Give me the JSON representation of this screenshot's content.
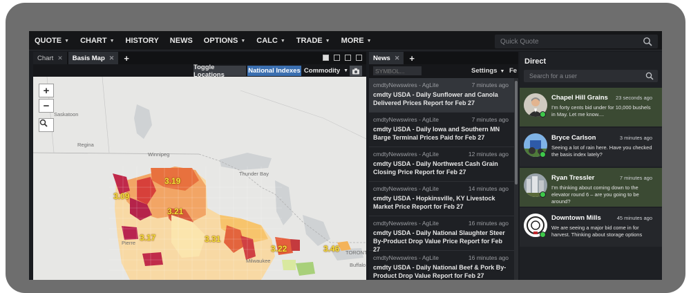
{
  "menu": {
    "items": [
      {
        "label": "QUOTE",
        "dropdown": true
      },
      {
        "label": "CHART",
        "dropdown": true
      },
      {
        "label": "HISTORY",
        "dropdown": false
      },
      {
        "label": "NEWS",
        "dropdown": false
      },
      {
        "label": "OPTIONS",
        "dropdown": true
      },
      {
        "label": "CALC",
        "dropdown": true
      },
      {
        "label": "TRADE",
        "dropdown": true
      },
      {
        "label": "MORE",
        "dropdown": true
      }
    ],
    "quick_quote_placeholder": "Quick Quote"
  },
  "left_panel": {
    "tabs": [
      {
        "label": "Chart",
        "active": false
      },
      {
        "label": "Basis Map",
        "active": true
      }
    ],
    "toolbar": {
      "toggle_locations": "Toggle Locations",
      "national_indexes": "National Indexes",
      "commodity": "Commodity"
    },
    "map": {
      "zoom_in": "+",
      "zoom_out": "−",
      "cities": [
        "Saskatoon",
        "Regina",
        "Winnipeg",
        "Thunder Bay",
        "Pierre",
        "Milwaukee",
        "TORONTO",
        "Buffalo"
      ],
      "basis_values": [
        "3.19",
        "3.09",
        "3.21",
        "3.17",
        "3.31",
        "3.22",
        "3.46"
      ]
    }
  },
  "news_panel": {
    "tab_label": "News",
    "symbol_placeholder": "SYMBOL...",
    "settings_label": "Settings",
    "clipped_label": "Fe",
    "items": [
      {
        "source": "cmdtyNewswires - AgLite",
        "time": "7 minutes ago",
        "title": "cmdty USDA - Daily Sunflower and Canola Delivered Prices Report for Feb 27"
      },
      {
        "source": "cmdtyNewswires - AgLite",
        "time": "7 minutes ago",
        "title": "cmdty USDA - Daily Iowa and Southern MN Barge Terminal Prices Paid for Feb 27"
      },
      {
        "source": "cmdtyNewswires - AgLite",
        "time": "12 minutes ago",
        "title": "cmdty USDA - Daily Northwest Cash Grain Closing Price Report for Feb 27"
      },
      {
        "source": "cmdtyNewswires - AgLite",
        "time": "14 minutes ago",
        "title": "cmdty USDA - Hopkinsville, KY Livestock Market Price Report for Feb 27"
      },
      {
        "source": "cmdtyNewswires - AgLite",
        "time": "16 minutes ago",
        "title": "cmdty USDA - Daily National Slaughter Steer By-Product Drop Value Price Report for Feb 27"
      },
      {
        "source": "cmdtyNewswires - AgLite",
        "time": "16 minutes ago",
        "title": "cmdty USDA - Daily National Beef & Pork By-Product Drop Value Report for Feb 27"
      }
    ]
  },
  "direct_panel": {
    "title": "Direct",
    "search_placeholder": "Search for a user",
    "chats": [
      {
        "name": "Chapel Hill Grains",
        "time": "23 seconds ago",
        "message": "I'm forty cents bid under for 10,000 bushels in May.  Let me know...."
      },
      {
        "name": "Bryce Carlson",
        "time": "3 minutes ago",
        "message": "Seeing a lot of rain here.  Have you checked the basis index lately?"
      },
      {
        "name": "Ryan Tressler",
        "time": "7 minutes ago",
        "message": "I'm thinking about coming down to the elevator round 6 – are you going to be around?"
      },
      {
        "name": "Downtown Mills",
        "time": "45 minutes ago",
        "message": "We are seeing a major bid come in for harvest.  Thinking about storage options"
      }
    ]
  },
  "colors": {
    "accent_blue": "#3b6fb0",
    "online_green": "#3ec94a",
    "chat_highlight": "#3b4a33"
  }
}
